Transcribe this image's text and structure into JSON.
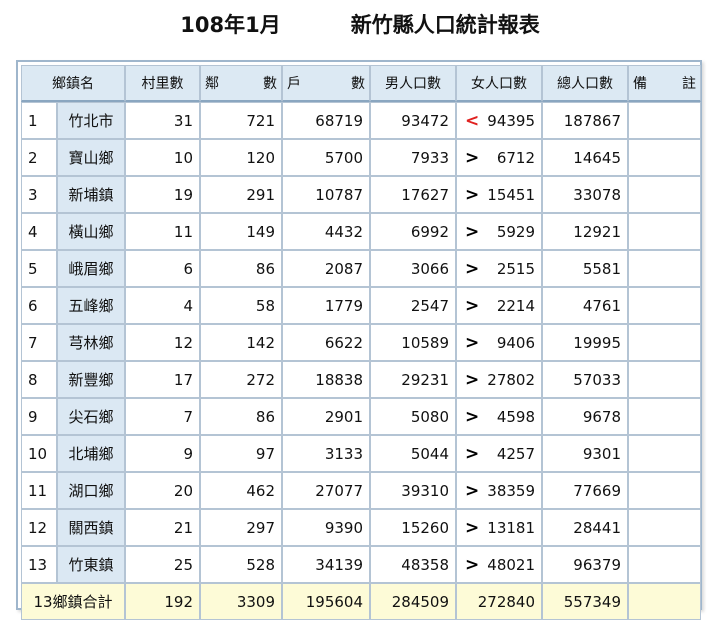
{
  "title": {
    "date": "108年1月",
    "name": "新竹縣人口統計報表"
  },
  "headers": {
    "town": "鄉鎮名",
    "villages": "村里數",
    "neighborhoods_a": "鄰",
    "neighborhoods_b": "數",
    "households_a": "戶",
    "households_b": "數",
    "male": "男人口數",
    "female": "女人口數",
    "total": "總人口數",
    "remarks_a": "備",
    "remarks_b": "註"
  },
  "rows": [
    {
      "idx": "1",
      "town": "竹北市",
      "villages": "31",
      "neighborhoods": "721",
      "households": "68719",
      "male": "93472",
      "cmp": "<",
      "female": "94395",
      "total": "187867",
      "remarks": ""
    },
    {
      "idx": "2",
      "town": "寶山鄉",
      "villages": "10",
      "neighborhoods": "120",
      "households": "5700",
      "male": "7933",
      "cmp": ">",
      "female": "6712",
      "total": "14645",
      "remarks": ""
    },
    {
      "idx": "3",
      "town": "新埔鎮",
      "villages": "19",
      "neighborhoods": "291",
      "households": "10787",
      "male": "17627",
      "cmp": ">",
      "female": "15451",
      "total": "33078",
      "remarks": ""
    },
    {
      "idx": "4",
      "town": "橫山鄉",
      "villages": "11",
      "neighborhoods": "149",
      "households": "4432",
      "male": "6992",
      "cmp": ">",
      "female": "5929",
      "total": "12921",
      "remarks": ""
    },
    {
      "idx": "5",
      "town": "峨眉鄉",
      "villages": "6",
      "neighborhoods": "86",
      "households": "2087",
      "male": "3066",
      "cmp": ">",
      "female": "2515",
      "total": "5581",
      "remarks": ""
    },
    {
      "idx": "6",
      "town": "五峰鄉",
      "villages": "4",
      "neighborhoods": "58",
      "households": "1779",
      "male": "2547",
      "cmp": ">",
      "female": "2214",
      "total": "4761",
      "remarks": ""
    },
    {
      "idx": "7",
      "town": "芎林鄉",
      "villages": "12",
      "neighborhoods": "142",
      "households": "6622",
      "male": "10589",
      "cmp": ">",
      "female": "9406",
      "total": "19995",
      "remarks": ""
    },
    {
      "idx": "8",
      "town": "新豐鄉",
      "villages": "17",
      "neighborhoods": "272",
      "households": "18838",
      "male": "29231",
      "cmp": ">",
      "female": "27802",
      "total": "57033",
      "remarks": ""
    },
    {
      "idx": "9",
      "town": "尖石鄉",
      "villages": "7",
      "neighborhoods": "86",
      "households": "2901",
      "male": "5080",
      "cmp": ">",
      "female": "4598",
      "total": "9678",
      "remarks": ""
    },
    {
      "idx": "10",
      "town": "北埔鄉",
      "villages": "9",
      "neighborhoods": "97",
      "households": "3133",
      "male": "5044",
      "cmp": ">",
      "female": "4257",
      "total": "9301",
      "remarks": ""
    },
    {
      "idx": "11",
      "town": "湖口鄉",
      "villages": "20",
      "neighborhoods": "462",
      "households": "27077",
      "male": "39310",
      "cmp": ">",
      "female": "38359",
      "total": "77669",
      "remarks": ""
    },
    {
      "idx": "12",
      "town": "關西鎮",
      "villages": "21",
      "neighborhoods": "297",
      "households": "9390",
      "male": "15260",
      "cmp": ">",
      "female": "13181",
      "total": "28441",
      "remarks": ""
    },
    {
      "idx": "13",
      "town": "竹東鎮",
      "villages": "25",
      "neighborhoods": "528",
      "households": "34139",
      "male": "48358",
      "cmp": ">",
      "female": "48021",
      "total": "96379",
      "remarks": ""
    }
  ],
  "summary": {
    "label": "13鄉鎮合計",
    "villages": "192",
    "neighborhoods": "3309",
    "households": "195604",
    "male": "284509",
    "female": "272840",
    "total": "557349",
    "remarks": ""
  },
  "colors": {
    "header_bg": "#dce9f3",
    "town_bg": "#dbe8f3",
    "total_bg": "#fdfbd7",
    "less_than": "#e0201f"
  }
}
